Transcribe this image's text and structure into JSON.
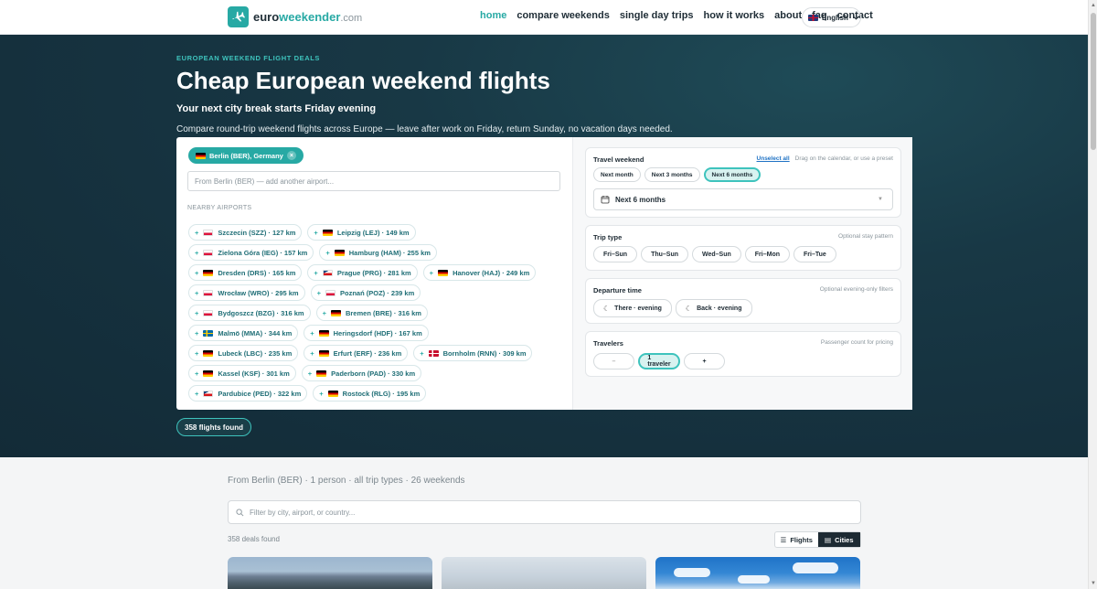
{
  "header": {
    "logo": {
      "part1": "euro",
      "part2": "weekender",
      "part3": ".com"
    },
    "nav": [
      {
        "label": "home",
        "active": true
      },
      {
        "label": "compare weekends"
      },
      {
        "label": "single day trips"
      },
      {
        "label": "how it works"
      },
      {
        "label": "about"
      },
      {
        "label": "faq"
      },
      {
        "label": "contact"
      }
    ],
    "language": "English"
  },
  "hero": {
    "eyebrow": "EUROPEAN WEEKEND FLIGHT DEALS",
    "title": "Cheap European weekend flights",
    "subtitle": "Your next city break starts Friday evening",
    "description": "Compare round-trip weekend flights across Europe — leave after work on Friday, return Sunday, no vacation days needed."
  },
  "origin": {
    "selected": "Berlin (BER), Germany",
    "input_placeholder": "From Berlin (BER) — add another airport...",
    "nearby_label": "NEARBY AIRPORTS",
    "nearby": [
      [
        {
          "label": "Szczecin (SZZ) · 127 km",
          "flag": "pl"
        },
        {
          "label": "Leipzig (LEJ) · 149 km",
          "flag": "de"
        }
      ],
      [
        {
          "label": "Zielona Góra (IEG) · 157 km",
          "flag": "pl"
        },
        {
          "label": "Hamburg (HAM) · 255 km",
          "flag": "de"
        }
      ],
      [
        {
          "label": "Dresden (DRS) · 165 km",
          "flag": "de"
        },
        {
          "label": "Prague (PRG) · 281 km",
          "flag": "cz"
        },
        {
          "label": "Hanover (HAJ) · 249 km",
          "flag": "de"
        }
      ],
      [
        {
          "label": "Wrocław (WRO) · 295 km",
          "flag": "pl"
        },
        {
          "label": "Poznań (POZ) · 239 km",
          "flag": "pl"
        }
      ],
      [
        {
          "label": "Bydgoszcz (BZG) · 316 km",
          "flag": "pl"
        },
        {
          "label": "Bremen (BRE) · 316 km",
          "flag": "de"
        }
      ],
      [
        {
          "label": "Malmö (MMA) · 344 km",
          "flag": "se"
        },
        {
          "label": "Heringsdorf (HDF) · 167 km",
          "flag": "de"
        }
      ],
      [
        {
          "label": "Lubeck (LBC) · 235 km",
          "flag": "de"
        },
        {
          "label": "Erfurt (ERF) · 236 km",
          "flag": "de"
        },
        {
          "label": "Bornholm (RNN) · 309 km",
          "flag": "dk"
        }
      ],
      [
        {
          "label": "Kassel (KSF) · 301 km",
          "flag": "de"
        },
        {
          "label": "Paderborn (PAD) · 330 km",
          "flag": "de"
        }
      ],
      [
        {
          "label": "Pardubice (PED) · 322 km",
          "flag": "cz"
        },
        {
          "label": "Rostock (RLG) · 195 km",
          "flag": "de"
        }
      ]
    ]
  },
  "travel_weekend": {
    "title": "Travel weekend",
    "unselect": "Unselect all",
    "hint": "Drag on the calendar, or use a preset",
    "presets": [
      {
        "label": "Next month"
      },
      {
        "label": "Next 3 months"
      },
      {
        "label": "Next 6 months",
        "active": true
      }
    ],
    "selected": "Next 6 months"
  },
  "trip_type": {
    "title": "Trip type",
    "hint": "Optional stay pattern",
    "options": [
      "Fri–Sun",
      "Thu–Sun",
      "Wed–Sun",
      "Fri–Mon",
      "Fri–Tue"
    ]
  },
  "departure_time": {
    "title": "Departure time",
    "hint": "Optional evening-only filters",
    "options": [
      "There · evening",
      "Back · evening"
    ]
  },
  "travelers": {
    "title": "Travelers",
    "hint": "Passenger count for pricing",
    "minus": "–",
    "value": "1 traveler",
    "plus": "+"
  },
  "results_pill": "358 flights found",
  "results": {
    "summary": "From Berlin (BER) · 1 person · all trip types · 26 weekends",
    "filter_placeholder": "Filter by city, airport, or country...",
    "deals_count": "358 deals found",
    "view_flights": "Flights",
    "view_cities": "Cities",
    "active_view": "Cities"
  },
  "colors": {
    "accent": "#27a9a4",
    "hero_bg": "#15303d"
  }
}
